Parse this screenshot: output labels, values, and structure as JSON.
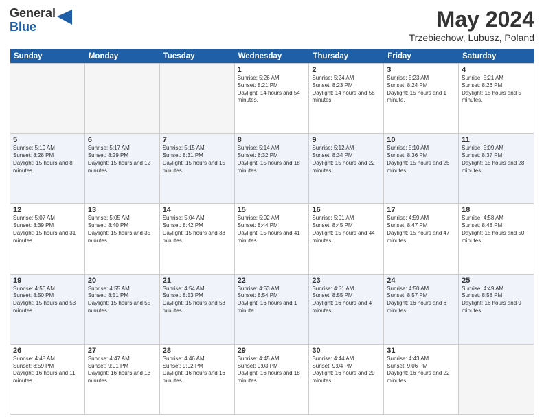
{
  "logo": {
    "general": "General",
    "blue": "Blue"
  },
  "title": {
    "month_year": "May 2024",
    "location": "Trzebiechow, Lubusz, Poland"
  },
  "calendar": {
    "days_of_week": [
      "Sunday",
      "Monday",
      "Tuesday",
      "Wednesday",
      "Thursday",
      "Friday",
      "Saturday"
    ],
    "rows": [
      {
        "shaded": false,
        "cells": [
          {
            "day": "",
            "empty": true
          },
          {
            "day": "",
            "empty": true
          },
          {
            "day": "",
            "empty": true
          },
          {
            "day": "1",
            "sunrise": "Sunrise: 5:26 AM",
            "sunset": "Sunset: 8:21 PM",
            "daylight": "Daylight: 14 hours and 54 minutes."
          },
          {
            "day": "2",
            "sunrise": "Sunrise: 5:24 AM",
            "sunset": "Sunset: 8:23 PM",
            "daylight": "Daylight: 14 hours and 58 minutes."
          },
          {
            "day": "3",
            "sunrise": "Sunrise: 5:23 AM",
            "sunset": "Sunset: 8:24 PM",
            "daylight": "Daylight: 15 hours and 1 minute."
          },
          {
            "day": "4",
            "sunrise": "Sunrise: 5:21 AM",
            "sunset": "Sunset: 8:26 PM",
            "daylight": "Daylight: 15 hours and 5 minutes."
          }
        ]
      },
      {
        "shaded": true,
        "cells": [
          {
            "day": "5",
            "sunrise": "Sunrise: 5:19 AM",
            "sunset": "Sunset: 8:28 PM",
            "daylight": "Daylight: 15 hours and 8 minutes."
          },
          {
            "day": "6",
            "sunrise": "Sunrise: 5:17 AM",
            "sunset": "Sunset: 8:29 PM",
            "daylight": "Daylight: 15 hours and 12 minutes."
          },
          {
            "day": "7",
            "sunrise": "Sunrise: 5:15 AM",
            "sunset": "Sunset: 8:31 PM",
            "daylight": "Daylight: 15 hours and 15 minutes."
          },
          {
            "day": "8",
            "sunrise": "Sunrise: 5:14 AM",
            "sunset": "Sunset: 8:32 PM",
            "daylight": "Daylight: 15 hours and 18 minutes."
          },
          {
            "day": "9",
            "sunrise": "Sunrise: 5:12 AM",
            "sunset": "Sunset: 8:34 PM",
            "daylight": "Daylight: 15 hours and 22 minutes."
          },
          {
            "day": "10",
            "sunrise": "Sunrise: 5:10 AM",
            "sunset": "Sunset: 8:36 PM",
            "daylight": "Daylight: 15 hours and 25 minutes."
          },
          {
            "day": "11",
            "sunrise": "Sunrise: 5:09 AM",
            "sunset": "Sunset: 8:37 PM",
            "daylight": "Daylight: 15 hours and 28 minutes."
          }
        ]
      },
      {
        "shaded": false,
        "cells": [
          {
            "day": "12",
            "sunrise": "Sunrise: 5:07 AM",
            "sunset": "Sunset: 8:39 PM",
            "daylight": "Daylight: 15 hours and 31 minutes."
          },
          {
            "day": "13",
            "sunrise": "Sunrise: 5:05 AM",
            "sunset": "Sunset: 8:40 PM",
            "daylight": "Daylight: 15 hours and 35 minutes."
          },
          {
            "day": "14",
            "sunrise": "Sunrise: 5:04 AM",
            "sunset": "Sunset: 8:42 PM",
            "daylight": "Daylight: 15 hours and 38 minutes."
          },
          {
            "day": "15",
            "sunrise": "Sunrise: 5:02 AM",
            "sunset": "Sunset: 8:44 PM",
            "daylight": "Daylight: 15 hours and 41 minutes."
          },
          {
            "day": "16",
            "sunrise": "Sunrise: 5:01 AM",
            "sunset": "Sunset: 8:45 PM",
            "daylight": "Daylight: 15 hours and 44 minutes."
          },
          {
            "day": "17",
            "sunrise": "Sunrise: 4:59 AM",
            "sunset": "Sunset: 8:47 PM",
            "daylight": "Daylight: 15 hours and 47 minutes."
          },
          {
            "day": "18",
            "sunrise": "Sunrise: 4:58 AM",
            "sunset": "Sunset: 8:48 PM",
            "daylight": "Daylight: 15 hours and 50 minutes."
          }
        ]
      },
      {
        "shaded": true,
        "cells": [
          {
            "day": "19",
            "sunrise": "Sunrise: 4:56 AM",
            "sunset": "Sunset: 8:50 PM",
            "daylight": "Daylight: 15 hours and 53 minutes."
          },
          {
            "day": "20",
            "sunrise": "Sunrise: 4:55 AM",
            "sunset": "Sunset: 8:51 PM",
            "daylight": "Daylight: 15 hours and 55 minutes."
          },
          {
            "day": "21",
            "sunrise": "Sunrise: 4:54 AM",
            "sunset": "Sunset: 8:53 PM",
            "daylight": "Daylight: 15 hours and 58 minutes."
          },
          {
            "day": "22",
            "sunrise": "Sunrise: 4:53 AM",
            "sunset": "Sunset: 8:54 PM",
            "daylight": "Daylight: 16 hours and 1 minute."
          },
          {
            "day": "23",
            "sunrise": "Sunrise: 4:51 AM",
            "sunset": "Sunset: 8:55 PM",
            "daylight": "Daylight: 16 hours and 4 minutes."
          },
          {
            "day": "24",
            "sunrise": "Sunrise: 4:50 AM",
            "sunset": "Sunset: 8:57 PM",
            "daylight": "Daylight: 16 hours and 6 minutes."
          },
          {
            "day": "25",
            "sunrise": "Sunrise: 4:49 AM",
            "sunset": "Sunset: 8:58 PM",
            "daylight": "Daylight: 16 hours and 9 minutes."
          }
        ]
      },
      {
        "shaded": false,
        "cells": [
          {
            "day": "26",
            "sunrise": "Sunrise: 4:48 AM",
            "sunset": "Sunset: 8:59 PM",
            "daylight": "Daylight: 16 hours and 11 minutes."
          },
          {
            "day": "27",
            "sunrise": "Sunrise: 4:47 AM",
            "sunset": "Sunset: 9:01 PM",
            "daylight": "Daylight: 16 hours and 13 minutes."
          },
          {
            "day": "28",
            "sunrise": "Sunrise: 4:46 AM",
            "sunset": "Sunset: 9:02 PM",
            "daylight": "Daylight: 16 hours and 16 minutes."
          },
          {
            "day": "29",
            "sunrise": "Sunrise: 4:45 AM",
            "sunset": "Sunset: 9:03 PM",
            "daylight": "Daylight: 16 hours and 18 minutes."
          },
          {
            "day": "30",
            "sunrise": "Sunrise: 4:44 AM",
            "sunset": "Sunset: 9:04 PM",
            "daylight": "Daylight: 16 hours and 20 minutes."
          },
          {
            "day": "31",
            "sunrise": "Sunrise: 4:43 AM",
            "sunset": "Sunset: 9:06 PM",
            "daylight": "Daylight: 16 hours and 22 minutes."
          },
          {
            "day": "",
            "empty": true
          }
        ]
      }
    ]
  }
}
